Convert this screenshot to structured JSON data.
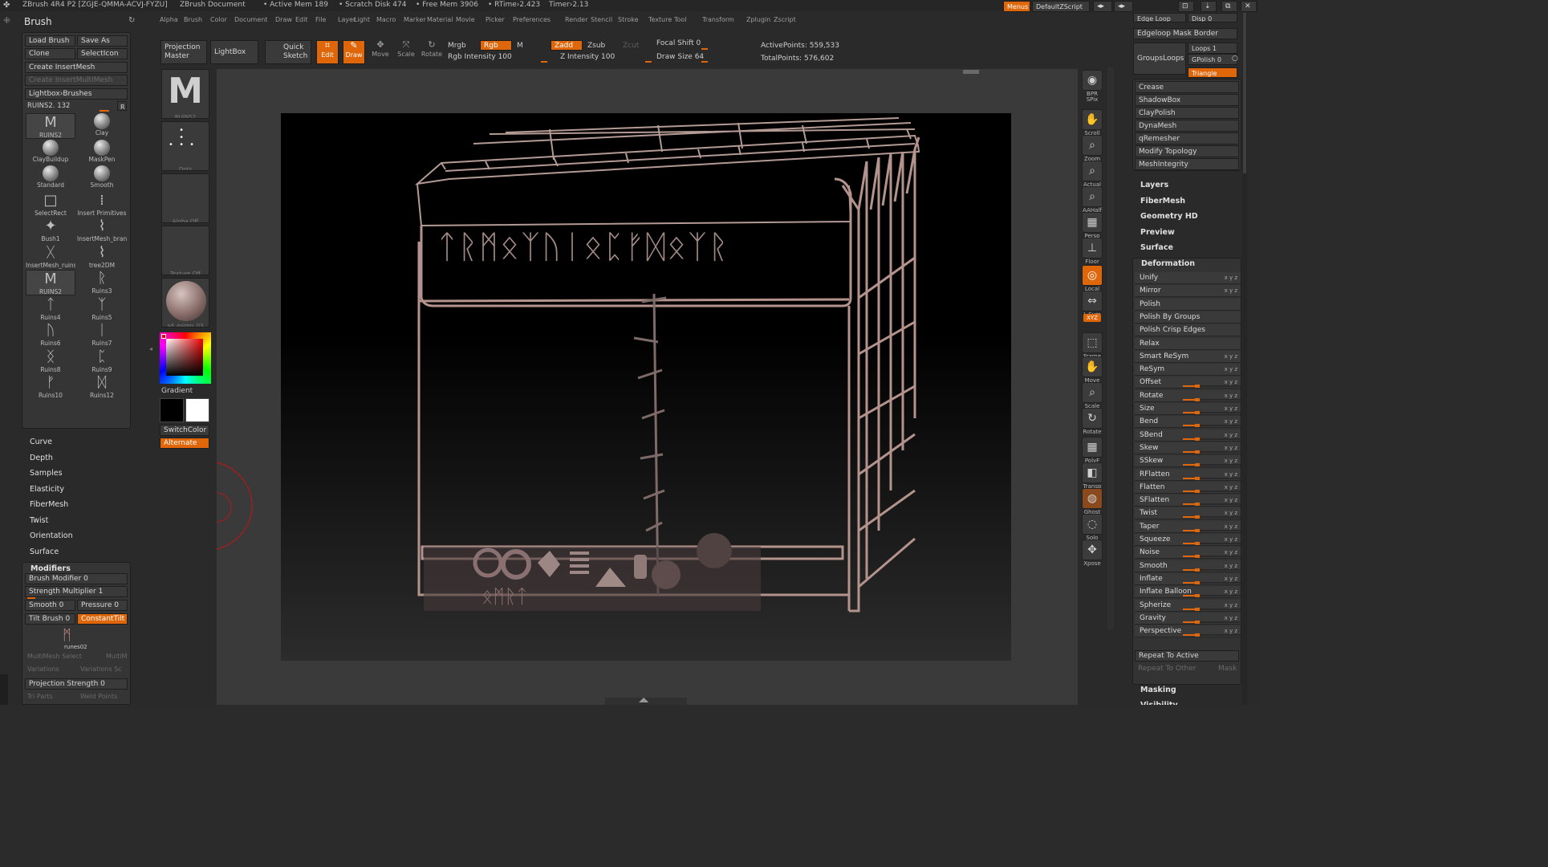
{
  "titlebar": {
    "app": "ZBrush 4R4 P2 [ZGJE-QMMA-ACVJ-FYZU]",
    "doc": "ZBrush Document",
    "active_mem": "• Active Mem 189",
    "scratch": "• Scratch Disk 474",
    "free_mem": "• Free Mem 3906",
    "rtime": "• RTime›2.423",
    "timer": "Timer›2.13",
    "menus": "Menus",
    "script": "DefaultZScript"
  },
  "menubar": [
    "Alpha",
    "Brush",
    "Color",
    "Document",
    "Draw",
    "Edit",
    "File",
    "Layer",
    "Light",
    "Macro",
    "Marker",
    "Material",
    "Movie",
    "Picker",
    "Preferences",
    "Render",
    "Stencil",
    "Stroke",
    "Texture",
    "Tool",
    "Transform",
    "Zplugin",
    "Zscript"
  ],
  "brush": {
    "title": "Brush",
    "load": "Load Brush",
    "save_as": "Save As",
    "clone": "Clone",
    "select_icon": "SelectIcon",
    "create_insert": "Create InsertMesh",
    "create_insert_multi": "Create InsertMultiMesh",
    "lightbox_brushes": "Lightbox›Brushes",
    "current": "RUINS2. 132",
    "r": "R",
    "items": [
      {
        "name": "RUINS2",
        "ic": "M"
      },
      {
        "name": "Clay",
        "ic": "●"
      },
      {
        "name": "ClayBuildup",
        "ic": "●"
      },
      {
        "name": "MaskPen",
        "ic": "●"
      },
      {
        "name": "Standard",
        "ic": "●"
      },
      {
        "name": "Smooth",
        "ic": "●"
      },
      {
        "name": "SelectRect",
        "ic": "□"
      },
      {
        "name": "Insert Primitives",
        "ic": "⁞"
      },
      {
        "name": "Bush1",
        "ic": "✦"
      },
      {
        "name": "InsertMesh_branc",
        "ic": "⌇"
      },
      {
        "name": "InsertMesh_ruins",
        "ic": "ᚷ"
      },
      {
        "name": "tree2DM",
        "ic": "⌇"
      },
      {
        "name": "RUINS2",
        "ic": "M"
      },
      {
        "name": "Ruins3",
        "ic": "ᚱ"
      },
      {
        "name": "Ruins4",
        "ic": "ᛏ"
      },
      {
        "name": "Ruins5",
        "ic": "ᛉ"
      },
      {
        "name": "Ruins6",
        "ic": "ᚢ"
      },
      {
        "name": "Ruins7",
        "ic": "ᛁ"
      },
      {
        "name": "Ruins8",
        "ic": "ᛝ"
      },
      {
        "name": "Ruins9",
        "ic": "ᛈ"
      },
      {
        "name": "Ruins10",
        "ic": "ᚠ"
      },
      {
        "name": "Ruins12",
        "ic": "ᛞ"
      }
    ]
  },
  "left_menu": [
    "Curve",
    "Depth",
    "Samples",
    "Elasticity",
    "FiberMesh",
    "Twist",
    "Orientation",
    "Surface"
  ],
  "modifiers": {
    "title": "Modifiers",
    "brush_modifier": "Brush Modifier 0",
    "strength_multiplier": "Strength Multiplier 1",
    "smooth": "Smooth 0",
    "pressure": "Pressure 0",
    "tilt_brush": "Tilt Brush 0",
    "constant_tilt": "ConstantTilt",
    "thumb": "runes02",
    "multimesh": "MultiMesh Select",
    "multim": "MultiM",
    "variations": "Variations",
    "variations_s": "Variations Sc",
    "projection_strength": "Projection Strength 0",
    "tri_parts": "Tri Parts",
    "weld_points": "Weld Points"
  },
  "shelf": {
    "projection_master": "Projection Master",
    "lightbox": "LightBox",
    "quick_sketch": "Quick Sketch",
    "edit": "Edit",
    "draw": "Draw",
    "move": "Move",
    "scale": "Scale",
    "rotate": "Rotate",
    "mrgb": "Mrgb",
    "rgb": "Rgb",
    "m": "M",
    "zadd": "Zadd",
    "zsub": "Zsub",
    "zcut": "Zcut",
    "rgb_intensity": "Rgb Intensity 100",
    "z_intensity": "Z Intensity 100",
    "focal_shift": "Focal Shift 0",
    "draw_size": "Draw Size 64",
    "active_points": "ActivePoints: 559,533",
    "total_points": "TotalPoints: 576,602"
  },
  "palette": {
    "ruins2": "RUINS2",
    "dots": "Dots",
    "alpha_off": "Alpha  Off",
    "texture_off": "Texture  Off",
    "material": "sd_asimo_03",
    "gradient": "Gradient",
    "switch_color": "SwitchColor",
    "alternate": "Alternate"
  },
  "right_toolbar": [
    {
      "name": "BPR",
      "ic": "◉"
    },
    {
      "name": "SPix",
      "ic": ""
    },
    {
      "name": "Scroll",
      "ic": "✋"
    },
    {
      "name": "Zoom",
      "ic": "⌕"
    },
    {
      "name": "Actual",
      "ic": "⌕"
    },
    {
      "name": "AAHalf",
      "ic": "⌕"
    },
    {
      "name": "Persp",
      "ic": "▦"
    },
    {
      "name": "Floor",
      "ic": "⊥"
    },
    {
      "name": "Local",
      "ic": "◎"
    },
    {
      "name": "L.Sym",
      "ic": "⇔"
    },
    {
      "name": "XYZ",
      "ic": ""
    },
    {
      "name": "Frame",
      "ic": "⬚"
    },
    {
      "name": "Move",
      "ic": "✋"
    },
    {
      "name": "Scale",
      "ic": "⌕"
    },
    {
      "name": "Rotate",
      "ic": "↻"
    },
    {
      "name": "PolyF",
      "ic": "▦"
    },
    {
      "name": "Transp",
      "ic": "◧"
    },
    {
      "name": "Ghost",
      "ic": "◍"
    },
    {
      "name": "Solo",
      "ic": "◌"
    },
    {
      "name": "Xpose",
      "ic": "✥"
    }
  ],
  "tool_panel": {
    "edge_loop": "Edge Loop",
    "disp": "Disp 0",
    "edgeloop_mask_border": "Edgeloop Mask Border",
    "groups_loops": "GroupsLoops",
    "loops": "Loops 1",
    "gpolish": "GPolish 0",
    "triangle": "Triangle",
    "crease": "Crease",
    "shadowbox": "ShadowBox",
    "claypolish": "ClayPolish",
    "dynamesh": "DynaMesh",
    "qremesher": "qRemesher",
    "modify_topology": "Modify Topology",
    "meshintegrity": "MeshIntegrity",
    "layers": "Layers",
    "fibermesh": "FiberMesh",
    "geometry_hd": "Geometry HD",
    "preview": "Preview",
    "surface": "Surface",
    "deformation": "Deformation",
    "repeat_to_active": "Repeat To Active",
    "repeat_to_other": "Repeat To Other",
    "mask": "Mask",
    "masking": "Masking",
    "visibility": "Visibility"
  },
  "deformation": [
    {
      "label": "Unify",
      "xyz": "x y z",
      "v": 0
    },
    {
      "label": "Mirror",
      "xyz": "x y z",
      "v": 0
    },
    {
      "label": "Polish",
      "xyz": "",
      "v": 0
    },
    {
      "label": "Polish By Groups",
      "xyz": "",
      "v": 0
    },
    {
      "label": "Polish Crisp Edges",
      "xyz": "",
      "v": 0
    },
    {
      "label": "Relax",
      "xyz": "",
      "v": 0
    },
    {
      "label": "Smart ReSym",
      "xyz": "x y z",
      "v": 0
    },
    {
      "label": "ReSym",
      "xyz": "x y z",
      "v": 0
    },
    {
      "label": "Offset",
      "xyz": "x y z",
      "v": 0.25
    },
    {
      "label": "Rotate",
      "xyz": "x y z",
      "v": 0.25
    },
    {
      "label": "Size",
      "xyz": "x y z",
      "v": 0.25
    },
    {
      "label": "Bend",
      "xyz": "x y z",
      "v": 0.25
    },
    {
      "label": "SBend",
      "xyz": "x y z",
      "v": 0.25
    },
    {
      "label": "Skew",
      "xyz": "x y z",
      "v": 0.25
    },
    {
      "label": "SSkew",
      "xyz": "x y z",
      "v": 0.25
    },
    {
      "label": "RFlatten",
      "xyz": "x y z",
      "v": 0.25
    },
    {
      "label": "Flatten",
      "xyz": "x y z",
      "v": 0.25
    },
    {
      "label": "SFlatten",
      "xyz": "x y z",
      "v": 0.25
    },
    {
      "label": "Twist",
      "xyz": "x y z",
      "v": 0.25
    },
    {
      "label": "Taper",
      "xyz": "x y z",
      "v": 0.25
    },
    {
      "label": "Squeeze",
      "xyz": "x y z",
      "v": 0.25
    },
    {
      "label": "Noise",
      "xyz": "x y z",
      "v": 0.25
    },
    {
      "label": "Smooth",
      "xyz": "x y z",
      "v": 0.25
    },
    {
      "label": "Inflate",
      "xyz": "x y z",
      "v": 0.25
    },
    {
      "label": "Inflate Balloon",
      "xyz": "x y z",
      "v": 0.25
    },
    {
      "label": "Spherize",
      "xyz": "x y z",
      "v": 0.25
    },
    {
      "label": "Gravity",
      "xyz": "x y z",
      "v": 0.25
    },
    {
      "label": "Perspective",
      "xyz": "x y z",
      "v": 0.25
    }
  ],
  "canvas": {
    "runes": "ᛏᚱᛗᛟᛉᚢᛁᛟᛈᚠᛞᛟᛉᚱ",
    "bottom_runes": "ᛟᛗᚱᛏ"
  },
  "colors": {
    "accent": "#e0660a",
    "panel": "#353535",
    "bg": "#2a2a2a"
  }
}
